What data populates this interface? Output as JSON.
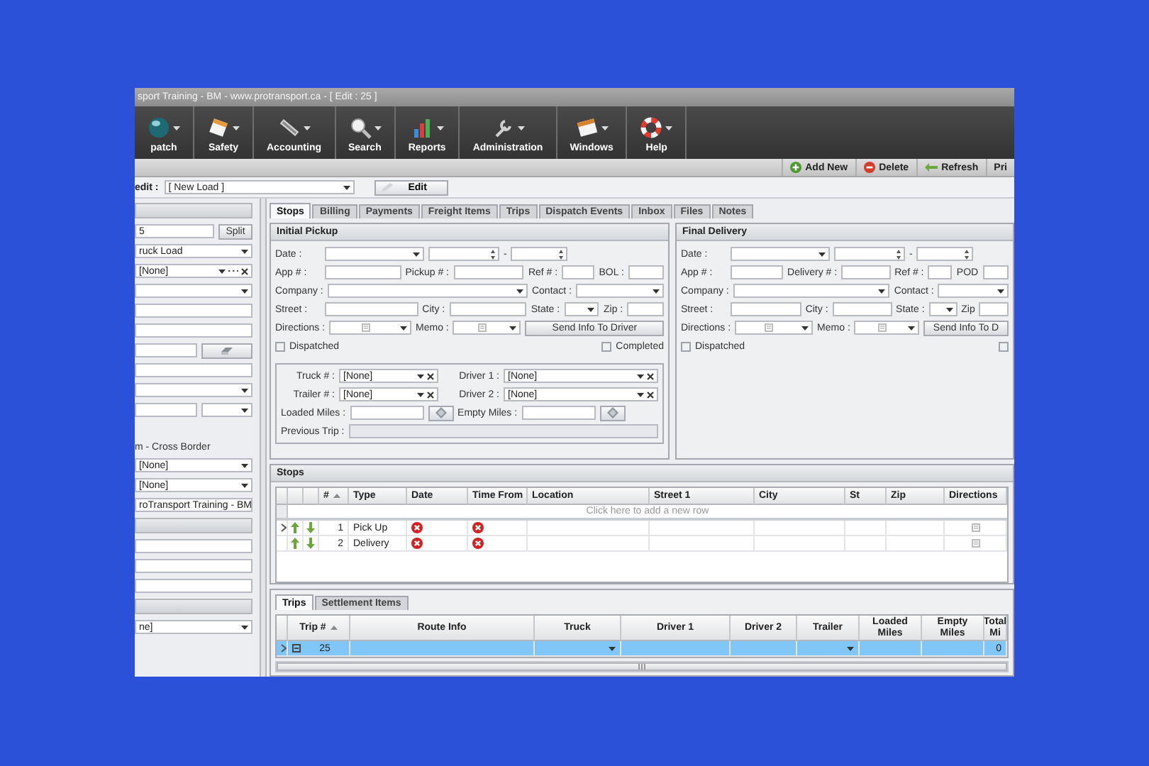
{
  "window": {
    "title": "sport Training - BM - www.protransport.ca - [ Edit : 25 ]"
  },
  "ribbon": [
    {
      "label": "patch"
    },
    {
      "label": "Safety"
    },
    {
      "label": "Accounting"
    },
    {
      "label": "Search"
    },
    {
      "label": "Reports"
    },
    {
      "label": "Administration"
    },
    {
      "label": "Windows"
    },
    {
      "label": "Help"
    }
  ],
  "actions": [
    {
      "label": "Add New",
      "kind": "add"
    },
    {
      "label": "Delete",
      "kind": "delete"
    },
    {
      "label": "Refresh",
      "kind": "refresh"
    },
    {
      "label": "Pri",
      "kind": "text"
    }
  ],
  "edit_bar": {
    "label": "edit :",
    "value": "[ New Load ]",
    "button": "Edit"
  },
  "left_panel": [
    {
      "kind": "header"
    },
    {
      "kind": "field-button",
      "value": "5",
      "button": "Split"
    },
    {
      "kind": "select",
      "value": "ruck Load"
    },
    {
      "kind": "select-clear",
      "value": "[None]"
    },
    {
      "kind": "select"
    },
    {
      "kind": "field"
    },
    {
      "kind": "field"
    },
    {
      "kind": "field-icon"
    },
    {
      "kind": "field"
    },
    {
      "kind": "select"
    },
    {
      "kind": "field-select"
    },
    {
      "kind": "text",
      "value": "m - Cross Border"
    },
    {
      "kind": "select",
      "value": "[None]"
    },
    {
      "kind": "select",
      "value": "[None]"
    },
    {
      "kind": "select",
      "value": "roTransport Training - BM"
    },
    {
      "kind": "header"
    },
    {
      "kind": "field"
    },
    {
      "kind": "field"
    },
    {
      "kind": "field"
    },
    {
      "kind": "header"
    },
    {
      "kind": "select",
      "value": "ne]"
    }
  ],
  "tabs": [
    {
      "label": "Stops",
      "selected": true
    },
    {
      "label": "Billing",
      "selected": false
    },
    {
      "label": "Payments",
      "selected": false
    },
    {
      "label": "Freight Items",
      "selected": false
    },
    {
      "label": "Trips",
      "selected": false
    },
    {
      "label": "Dispatch Events",
      "selected": false
    },
    {
      "label": "Inbox",
      "selected": false
    },
    {
      "label": "Files",
      "selected": false
    },
    {
      "label": "Notes",
      "selected": false
    }
  ],
  "initial_pickup": {
    "title": "Initial Pickup",
    "date_label": "Date :",
    "time_separator": "-",
    "app_label": "App # :",
    "number_label": "Pickup # :",
    "ref_label": "Ref # :",
    "bol_label": "BOL :",
    "company_label": "Company :",
    "contact_label": "Contact :",
    "street_label": "Street :",
    "city_label": "City :",
    "state_label": "State :",
    "zip_label": "Zip :",
    "directions_label": "Directions :",
    "memo_label": "Memo :",
    "send_button": "Send Info To Driver",
    "dispatched": {
      "label": "Dispatched",
      "checked": false
    },
    "completed": {
      "label": "Completed",
      "checked": false
    },
    "assignment": {
      "truck_label": "Truck # :",
      "truck": "[None]",
      "driver1_label": "Driver 1 :",
      "driver1": "[None]",
      "trailer_label": "Trailer # :",
      "trailer": "[None]",
      "driver2_label": "Driver 2 :",
      "driver2": "[None]",
      "loaded_label": "Loaded Miles :",
      "empty_label": "Empty Miles :",
      "previous_label": "Previous Trip :"
    }
  },
  "final_delivery": {
    "title": "Final Delivery",
    "date_label": "Date :",
    "time_separator": "-",
    "app_label": "App # :",
    "number_label": "Delivery # :",
    "ref_label": "Ref # :",
    "bol_label": "POD",
    "company_label": "Company :",
    "contact_label": "Contact :",
    "street_label": "Street :",
    "city_label": "City :",
    "state_label": "State :",
    "zip_label": "Zip",
    "directions_label": "Directions :",
    "memo_label": "Memo :",
    "send_button": "Send Info To D",
    "dispatched": {
      "label": "Dispatched",
      "checked": false
    },
    "completed": {
      "checked": false
    }
  },
  "stops": {
    "title": "Stops",
    "columns": [
      "#",
      "Type",
      "Date",
      "Time From",
      "Location",
      "Street 1",
      "City",
      "St",
      "Zip",
      "Directions"
    ],
    "new_row": "Click here to add a new row",
    "rows": [
      {
        "number": "1",
        "type": "Pick Up",
        "date_error": true,
        "time_error": true,
        "current": true
      },
      {
        "number": "2",
        "type": "Delivery",
        "date_error": true,
        "time_error": true,
        "current": false
      }
    ]
  },
  "trips": {
    "tabs": [
      {
        "label": "Trips",
        "selected": true
      },
      {
        "label": "Settlement Items",
        "selected": false
      }
    ],
    "columns": [
      "Trip #",
      "Route Info",
      "Truck",
      "Driver 1",
      "Driver 2",
      "Trailer",
      "Loaded Miles",
      "Empty Miles",
      "Total Mi"
    ],
    "rows": [
      {
        "trip": "25",
        "total": "0",
        "selected": true,
        "expanded": true,
        "current": true
      }
    ]
  }
}
